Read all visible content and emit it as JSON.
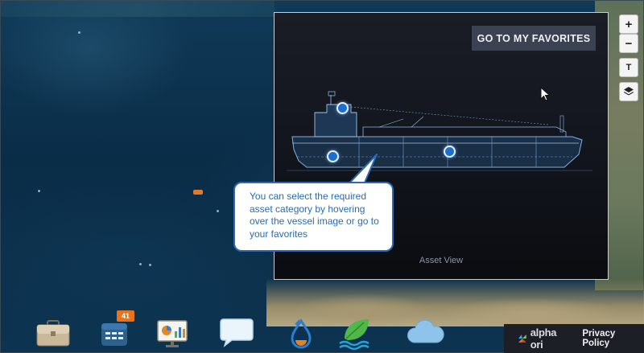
{
  "map": {
    "controls": {
      "zoom_in": "+",
      "zoom_out": "−",
      "text_toggle": "T"
    }
  },
  "panel": {
    "favorites_button": "GO TO MY FAVORITES",
    "footer_label": "Asset View"
  },
  "tooltip": {
    "text": "You can select the required asset category by hovering over the vessel image or go to your favorites"
  },
  "dock": {
    "items": [
      {
        "name": "briefcase",
        "icon": "briefcase-icon"
      },
      {
        "name": "calendar",
        "icon": "calendar-icon",
        "badge": "41"
      },
      {
        "name": "reports",
        "icon": "presentation-chart-icon"
      },
      {
        "name": "messages",
        "icon": "chat-bubble-icon"
      },
      {
        "name": "fuel",
        "icon": "fuel-drop-icon"
      },
      {
        "name": "environment",
        "icon": "leaf-wave-icon"
      },
      {
        "name": "weather",
        "icon": "cloud-icon"
      }
    ]
  },
  "footer": {
    "brand": "alpha ori",
    "privacy": "Privacy Policy"
  },
  "colors": {
    "accent_blue": "#2a6bb3",
    "badge_orange": "#e7731f",
    "button_bg": "#3b4252"
  }
}
